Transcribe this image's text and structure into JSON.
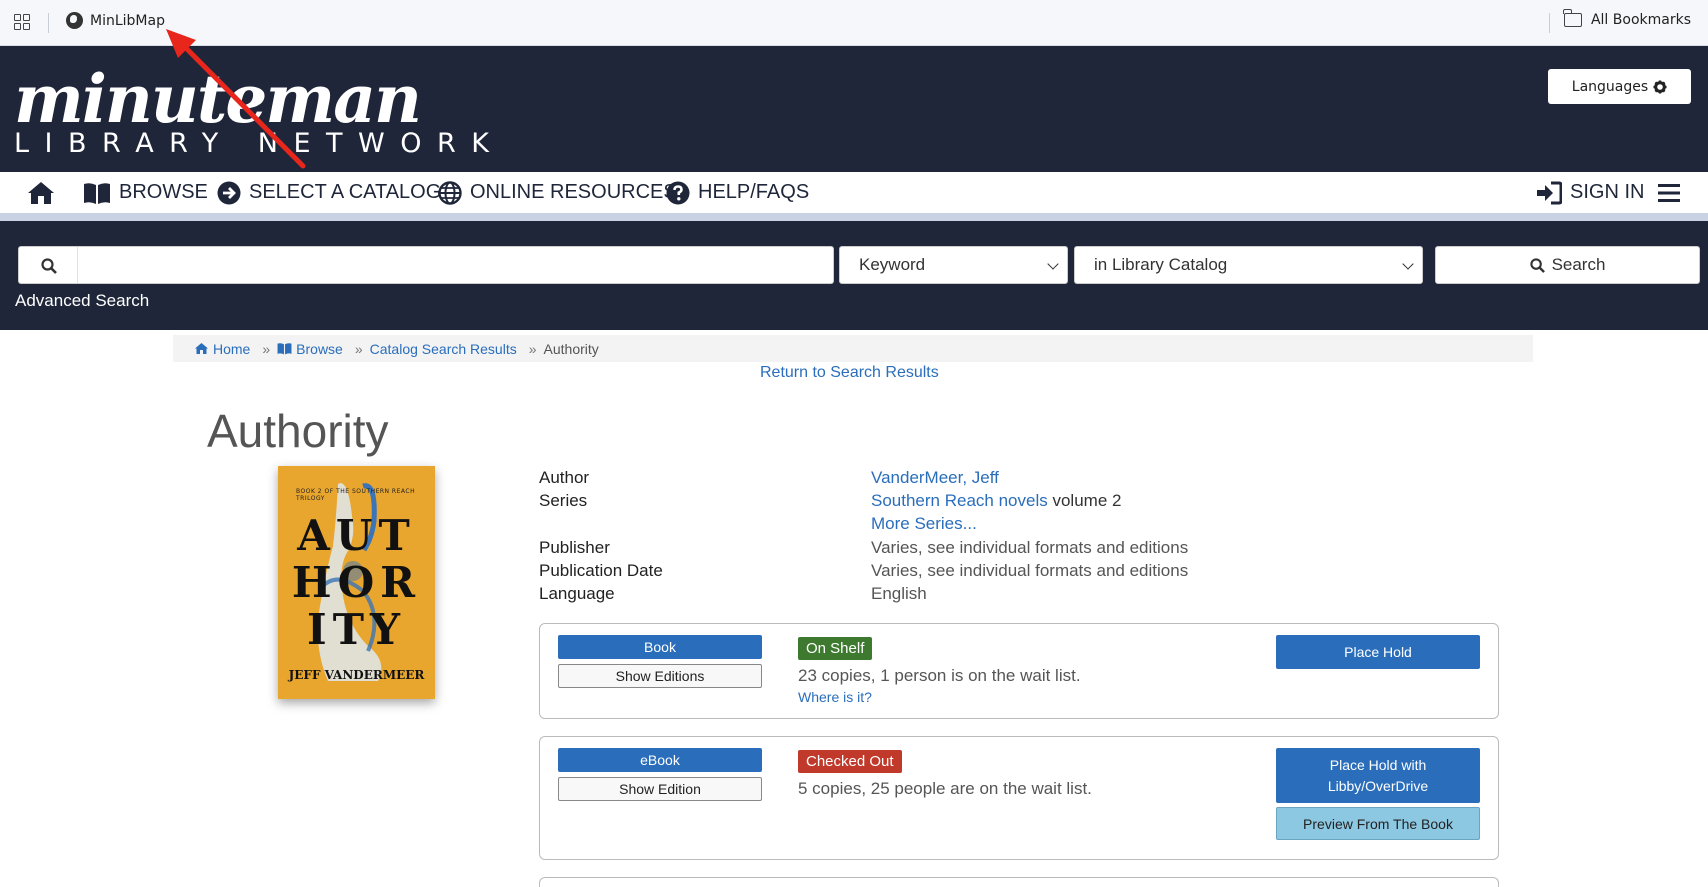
{
  "bookmarks_bar": {
    "bookmark_label": "MinLibMap",
    "all_bookmarks_label": "All Bookmarks"
  },
  "header": {
    "logo_main": "minuteman",
    "logo_sub": "LIBRARY NETWORK",
    "languages_label": "Languages"
  },
  "nav": {
    "items": [
      {
        "label": "BROWSE",
        "icon": "book-icon"
      },
      {
        "label": "SELECT A CATALOG",
        "icon": "arrow-circle-icon"
      },
      {
        "label": "ONLINE RESOURCES",
        "icon": "globe-icon"
      },
      {
        "label": "HELP/FAQS",
        "icon": "question-circle-icon"
      }
    ],
    "sign_in_label": "SIGN IN"
  },
  "search": {
    "query": "",
    "search_type": "Keyword",
    "search_source": "in Library Catalog",
    "search_button": "Search",
    "advanced_label": "Advanced Search"
  },
  "breadcrumb": {
    "home": "Home",
    "browse": "Browse",
    "results": "Catalog Search Results",
    "current": "Authority"
  },
  "return_link": "Return to Search Results",
  "record": {
    "title": "Authority",
    "cover": {
      "tagline": "BOOK 2 OF THE SOUTHERN REACH TRILOGY",
      "title_lines": [
        "AUT",
        "HOR",
        "ITY"
      ],
      "author": "JEFF VANDERMEER"
    },
    "details": {
      "author_label": "Author",
      "author_value": "VanderMeer, Jeff",
      "series_label": "Series",
      "series_value": "Southern Reach novels",
      "series_volume": "volume 2",
      "more_series": "More Series...",
      "publisher_label": "Publisher",
      "publisher_value": "Varies, see individual formats and editions",
      "pubdate_label": "Publication Date",
      "pubdate_value": "Varies, see individual formats and editions",
      "language_label": "Language",
      "language_value": "English"
    },
    "formats": [
      {
        "format": "Book",
        "editions_button": "Show Editions",
        "status": "On Shelf",
        "status_color": "#3d7a2f",
        "copies": "23 copies, 1 person is on the wait list.",
        "where_link": "Where is it?",
        "hold_button": "Place Hold"
      },
      {
        "format": "eBook",
        "editions_button": "Show Edition",
        "status": "Checked Out",
        "status_color": "#c0392b",
        "copies": "5 copies, 25 people are on the wait list.",
        "hold_button": "Place Hold with Libby/OverDrive",
        "preview_button": "Preview From The Book"
      }
    ]
  },
  "colors": {
    "header_bg": "#1f2639",
    "link": "#2a6ebb",
    "primary_button": "#2a6ebb",
    "preview_button": "#8dc8e2"
  }
}
